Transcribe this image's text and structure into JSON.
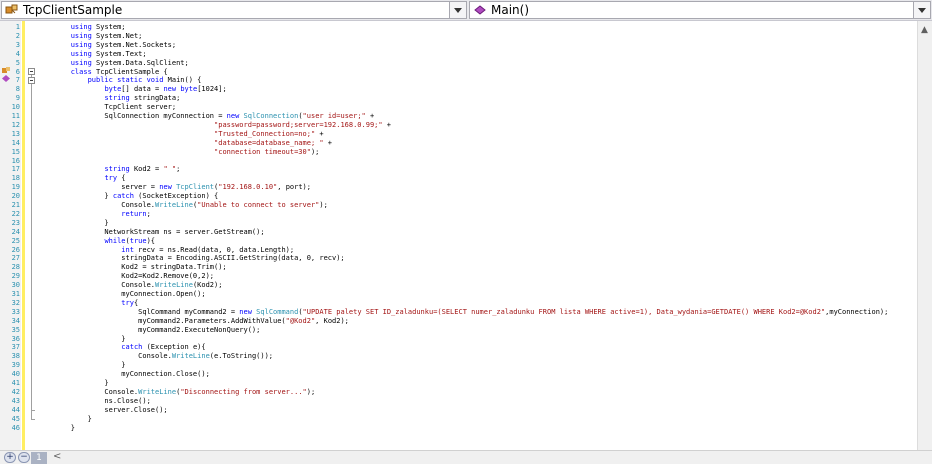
{
  "header": {
    "class_combo": "TcpClientSample",
    "member_combo": "Main()"
  },
  "zoom": {
    "level": "1"
  },
  "markers": {
    "line6": "class-icon",
    "line7": "method-icon"
  },
  "code": {
    "lines": [
      [
        {
          "t": "        "
        },
        {
          "t": "using",
          "c": "kw"
        },
        {
          "t": " System;"
        }
      ],
      [
        {
          "t": "        "
        },
        {
          "t": "using",
          "c": "kw"
        },
        {
          "t": " System.Net;"
        }
      ],
      [
        {
          "t": "        "
        },
        {
          "t": "using",
          "c": "kw"
        },
        {
          "t": " System.Net.Sockets;"
        }
      ],
      [
        {
          "t": "        "
        },
        {
          "t": "using",
          "c": "kw"
        },
        {
          "t": " System.Text;"
        }
      ],
      [
        {
          "t": "        "
        },
        {
          "t": "using",
          "c": "kw"
        },
        {
          "t": " System.Data.SqlClient;"
        }
      ],
      [
        {
          "t": "        "
        },
        {
          "t": "class",
          "c": "kw"
        },
        {
          "t": " TcpClientSample {"
        }
      ],
      [
        {
          "t": "            "
        },
        {
          "t": "public static void",
          "c": "kw"
        },
        {
          "t": " Main() {"
        }
      ],
      [
        {
          "t": "                "
        },
        {
          "t": "byte",
          "c": "kw"
        },
        {
          "t": "[] data = "
        },
        {
          "t": "new",
          "c": "kw"
        },
        {
          "t": " "
        },
        {
          "t": "byte",
          "c": "kw"
        },
        {
          "t": "[1024];"
        }
      ],
      [
        {
          "t": "                "
        },
        {
          "t": "string",
          "c": "kw"
        },
        {
          "t": " stringData;"
        }
      ],
      [
        {
          "t": "                TcpClient server;"
        }
      ],
      [
        {
          "t": "                SqlConnection myConnection = "
        },
        {
          "t": "new",
          "c": "kw"
        },
        {
          "t": " "
        },
        {
          "t": "SqlConnection",
          "c": "ty"
        },
        {
          "t": "("
        },
        {
          "t": "\"user id=user;\"",
          "c": "st"
        },
        {
          "t": " +"
        }
      ],
      [
        {
          "t": "                                          "
        },
        {
          "t": "\"password=password;server=192.168.0.99;\"",
          "c": "st"
        },
        {
          "t": " +"
        }
      ],
      [
        {
          "t": "                                          "
        },
        {
          "t": "\"Trusted_Connection=no;\"",
          "c": "st"
        },
        {
          "t": " +"
        }
      ],
      [
        {
          "t": "                                          "
        },
        {
          "t": "\"database=database_name; \"",
          "c": "st"
        },
        {
          "t": " +"
        }
      ],
      [
        {
          "t": "                                          "
        },
        {
          "t": "\"connection timeout=30\"",
          "c": "st"
        },
        {
          "t": ");"
        }
      ],
      [
        {
          "t": ""
        }
      ],
      [
        {
          "t": "                "
        },
        {
          "t": "string",
          "c": "kw"
        },
        {
          "t": " Kod2 = "
        },
        {
          "t": "\" \"",
          "c": "st"
        },
        {
          "t": ";"
        }
      ],
      [
        {
          "t": "                "
        },
        {
          "t": "try",
          "c": "kw"
        },
        {
          "t": " {"
        }
      ],
      [
        {
          "t": "                    server = "
        },
        {
          "t": "new",
          "c": "kw"
        },
        {
          "t": " "
        },
        {
          "t": "TcpClient",
          "c": "ty"
        },
        {
          "t": "("
        },
        {
          "t": "\"192.168.0.10\"",
          "c": "st"
        },
        {
          "t": ", port);"
        }
      ],
      [
        {
          "t": "                } "
        },
        {
          "t": "catch",
          "c": "kw"
        },
        {
          "t": " (SocketException) {"
        }
      ],
      [
        {
          "t": "                    Console."
        },
        {
          "t": "WriteLine",
          "c": "ty"
        },
        {
          "t": "("
        },
        {
          "t": "\"Unable to connect to server\"",
          "c": "st"
        },
        {
          "t": ");"
        }
      ],
      [
        {
          "t": "                    "
        },
        {
          "t": "return",
          "c": "kw"
        },
        {
          "t": ";"
        }
      ],
      [
        {
          "t": "                }"
        }
      ],
      [
        {
          "t": "                NetworkStream ns = server.GetStream();"
        }
      ],
      [
        {
          "t": "                "
        },
        {
          "t": "while",
          "c": "kw"
        },
        {
          "t": "("
        },
        {
          "t": "true",
          "c": "kw"
        },
        {
          "t": "){"
        }
      ],
      [
        {
          "t": "                    "
        },
        {
          "t": "int",
          "c": "kw"
        },
        {
          "t": " recv = ns.Read(data, 0, data.Length);"
        }
      ],
      [
        {
          "t": "                    stringData = Encoding.ASCII.GetString(data, 0, recv);"
        }
      ],
      [
        {
          "t": "                    Kod2 = stringData.Trim();"
        }
      ],
      [
        {
          "t": "                    Kod2=Kod2.Remove(0,2);"
        }
      ],
      [
        {
          "t": "                    Console."
        },
        {
          "t": "WriteLine",
          "c": "ty"
        },
        {
          "t": "(Kod2);"
        }
      ],
      [
        {
          "t": "                    myConnection.Open();"
        }
      ],
      [
        {
          "t": "                    "
        },
        {
          "t": "try",
          "c": "kw"
        },
        {
          "t": "{"
        }
      ],
      [
        {
          "t": "                        SqlCommand myCommand2 = "
        },
        {
          "t": "new",
          "c": "kw"
        },
        {
          "t": " "
        },
        {
          "t": "SqlCommand",
          "c": "ty"
        },
        {
          "t": "("
        },
        {
          "t": "\"UPDATE palety SET ID_zaladunku=(SELECT numer_zaladunku FROM lista WHERE active=1), Data_wydania=GETDATE() WHERE Kod2=@Kod2\"",
          "c": "st"
        },
        {
          "t": ",myConnection);"
        }
      ],
      [
        {
          "t": "                        myCommand2.Parameters.AddWithValue("
        },
        {
          "t": "\"@Kod2\"",
          "c": "st"
        },
        {
          "t": ", Kod2);"
        }
      ],
      [
        {
          "t": "                        myCommand2.ExecuteNonQuery();"
        }
      ],
      [
        {
          "t": "                    }"
        }
      ],
      [
        {
          "t": "                    "
        },
        {
          "t": "catch",
          "c": "kw"
        },
        {
          "t": " (Exception e){"
        }
      ],
      [
        {
          "t": "                        Console."
        },
        {
          "t": "WriteLine",
          "c": "ty"
        },
        {
          "t": "(e.ToString());"
        }
      ],
      [
        {
          "t": "                    }"
        }
      ],
      [
        {
          "t": "                    myConnection.Close();"
        }
      ],
      [
        {
          "t": "                }"
        }
      ],
      [
        {
          "t": "                Console."
        },
        {
          "t": "WriteLine",
          "c": "ty"
        },
        {
          "t": "("
        },
        {
          "t": "\"Disconnecting from server...\"",
          "c": "st"
        },
        {
          "t": ");"
        }
      ],
      [
        {
          "t": "                ns.Close();"
        }
      ],
      [
        {
          "t": "                server.Close();"
        }
      ],
      [
        {
          "t": "            }"
        }
      ],
      [
        {
          "t": "        }"
        }
      ]
    ]
  }
}
